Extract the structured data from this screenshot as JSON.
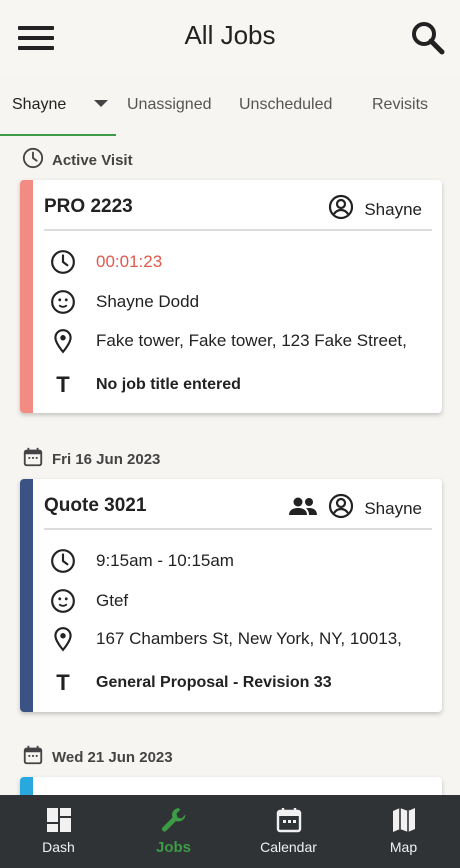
{
  "header": {
    "title": "All Jobs"
  },
  "tabs": [
    {
      "label": "Shayne",
      "active": true
    },
    {
      "label": "Unassigned"
    },
    {
      "label": "Unscheduled"
    },
    {
      "label": "Revisits"
    }
  ],
  "sections": [
    {
      "heading": "Active Visit",
      "card": {
        "title": "PRO 2223",
        "assignee": "Shayne",
        "accent_color": "#f28b82",
        "time": "00:01:23",
        "time_color": "#e0594d",
        "contact": "Shayne Dodd",
        "address": "Fake tower, Fake tower, 123 Fake Street,",
        "job_title": "No job title entered"
      }
    },
    {
      "heading": "Fri 16 Jun 2023",
      "card": {
        "title": "Quote 3021",
        "assignee": "Shayne",
        "accent_color": "#3b5284",
        "time": "9:15am - 10:15am",
        "contact": "Gtef",
        "address": "167 Chambers St, New York, NY, 10013,",
        "job_title": "General Proposal - Revision 33"
      }
    },
    {
      "heading": "Wed 21 Jun 2023",
      "card": {
        "accent_color": "#29a8e0"
      }
    }
  ],
  "nav": [
    {
      "label": "Dash",
      "icon": "dashboard-icon"
    },
    {
      "label": "Jobs",
      "icon": "wrench-icon",
      "active": true
    },
    {
      "label": "Calendar",
      "icon": "calendar-icon"
    },
    {
      "label": "Map",
      "icon": "map-icon"
    }
  ],
  "colors": {
    "accent_green": "#3d9a45",
    "navbar_bg": "#2f3336"
  }
}
